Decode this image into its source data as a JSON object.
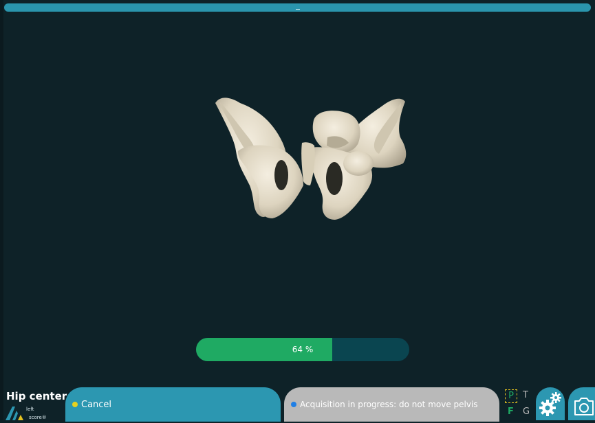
{
  "header": {
    "handle": "–"
  },
  "progress": {
    "value": 64,
    "label": "64 %"
  },
  "footer": {
    "title": "Hip center",
    "brand_word1": "left",
    "brand_word2": "score®",
    "cancel_label": "Cancel",
    "status_text": "Acquisition in progress: do not move pelvis"
  },
  "planes": {
    "p": "P",
    "t": "T",
    "f": "F",
    "g": "G"
  },
  "icons": {
    "cancel_dot": "yellow-dot-icon",
    "status_dot": "blue-dot-icon",
    "settings": "gear-icon",
    "screenshot": "camera-icon"
  },
  "colors": {
    "background": "#0e2228",
    "accent": "#2c97b1",
    "progress_fill": "#1faa63",
    "progress_track": "#0a4550",
    "status_bg": "#b9b9b9",
    "highlight": "#e6c31f",
    "bone": "#e2dac6"
  }
}
